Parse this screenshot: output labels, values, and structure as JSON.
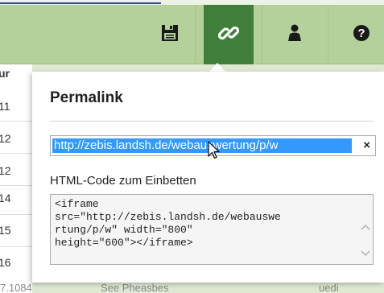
{
  "toolbar": {
    "buttons": [
      {
        "name": "save-icon",
        "active": false
      },
      {
        "name": "link-icon",
        "active": true
      },
      {
        "name": "person-icon",
        "active": false
      },
      {
        "name": "help-icon",
        "active": false
      }
    ],
    "active_color": "#3f7f3a",
    "bg_color": "#b5d19b"
  },
  "table": {
    "header_stub": "ur",
    "rows": [
      "11",
      "12",
      "12",
      "14",
      "15",
      "16"
    ],
    "bottom_left": "7.1084",
    "bottom_mid": "See  Pheasbes",
    "bottom_right": "uedi"
  },
  "popup": {
    "title": "Permalink",
    "url_value": "http://zebis.landsh.de/webauswertung/p/w",
    "clear_label": "×",
    "embed_label": "HTML-Code zum Einbetten",
    "embed_code": "<iframe\nsrc=\"http://zebis.landsh.de/webauswe\nrtung/p/w\" width=\"800\"\nheight=\"600\"></iframe>"
  }
}
